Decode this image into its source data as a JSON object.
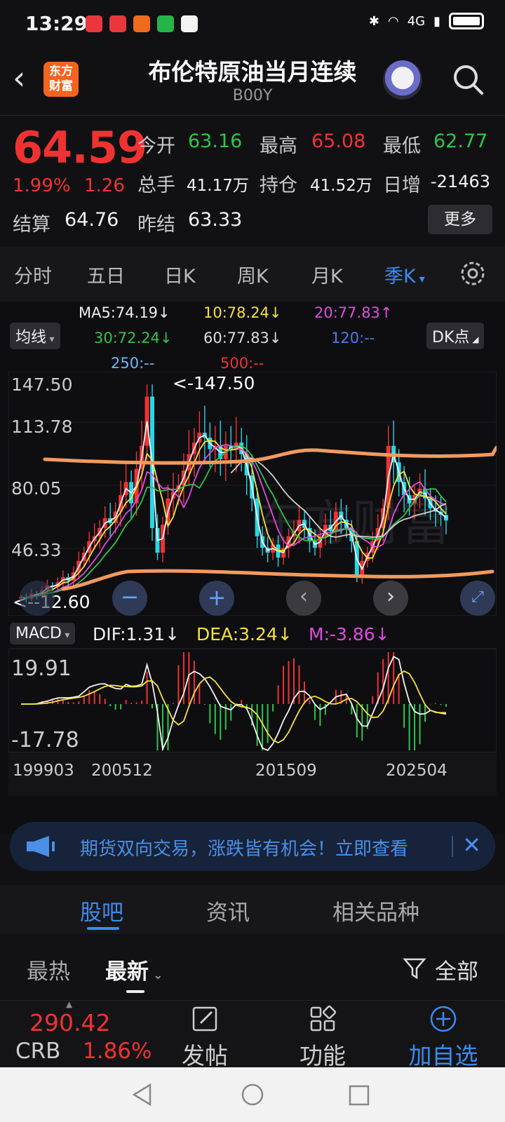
{
  "status_bar": {
    "time": "13:29",
    "network": "4G"
  },
  "header": {
    "title": "布伦特原油当月连续",
    "code": "B00Y",
    "logo_text": "东方财富"
  },
  "quote": {
    "price": "64.59",
    "change_pct": "1.99%",
    "change": "1.26",
    "open_label": "今开",
    "open": "63.16",
    "high_label": "最高",
    "high": "65.08",
    "low_label": "最低",
    "low": "62.77",
    "volume_label": "总手",
    "volume": "41.17万",
    "position_label": "持仓",
    "position": "41.52万",
    "daily_inc_label": "日增",
    "daily_inc": "-21463",
    "settle_label": "结算",
    "settle": "64.76",
    "prev_settle_label": "昨结",
    "prev_settle": "63.33",
    "more_label": "更多"
  },
  "period_tabs": [
    "分时",
    "五日",
    "日K",
    "周K",
    "月K",
    "季K"
  ],
  "active_period": "季K",
  "indicators": {
    "ma_selector": "均线",
    "ma5": "MA5:74.19↓",
    "ma10": "10:78.24↓",
    "ma20": "20:77.83↑",
    "ma30": "30:72.24↓",
    "ma60": "60:77.83↓",
    "ma120": "120:--",
    "ma250": "250:--",
    "ma500": "500:--",
    "dk_label": "DK点",
    "macd_selector": "MACD",
    "dif": "DIF:1.31↓",
    "dea": "DEA:3.24↓",
    "m": "M:-3.86↓"
  },
  "chart": {
    "y_ticks": [
      "147.50",
      "113.78",
      "80.05",
      "46.33",
      "12.60"
    ],
    "max_marker": "<-147.50",
    "min_marker": "<--12.60",
    "macd_ticks": [
      "19.91",
      "-17.78"
    ],
    "x_ticks": [
      "199903",
      "200512",
      "201509",
      "202504"
    ]
  },
  "chart_data": {
    "type": "candlestick",
    "x_range": [
      "199903",
      "202504"
    ],
    "ylim": [
      12.6,
      147.5
    ],
    "max": 147.5,
    "min": 12.6,
    "last_close": 64.59,
    "macd": {
      "ylim": [
        -17.78,
        19.91
      ],
      "dif": 1.31,
      "dea": 3.24,
      "m": -3.86
    }
  },
  "colors": {
    "up": "#f03232",
    "down": "#2ad6e6",
    "accent": "#3c8bf0",
    "drawn_line": "#f29a5e"
  },
  "banner": {
    "text": "期货双向交易，涨跌皆有机会！立即查看"
  },
  "section_tabs": [
    "股吧",
    "资讯",
    "相关品种"
  ],
  "filters": {
    "hot": "最热",
    "latest": "最新",
    "all": "全部"
  },
  "toolbar": {
    "ref_price": "290.42",
    "ref_name": "CRB",
    "ref_pct": "1.86%",
    "post": "发帖",
    "functions": "功能",
    "add_watch": "加自选"
  }
}
